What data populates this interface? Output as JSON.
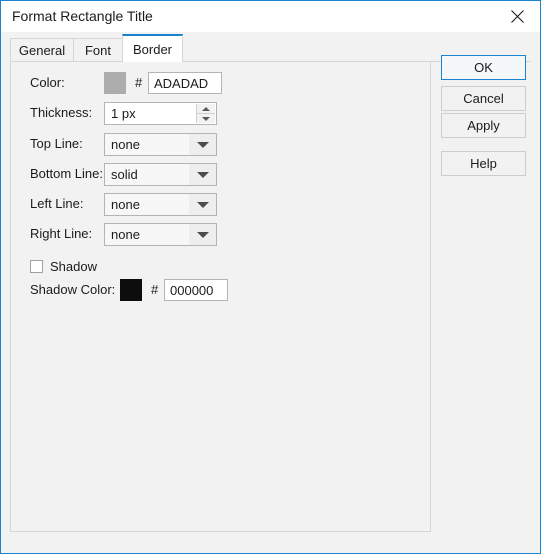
{
  "window": {
    "title": "Format Rectangle Title",
    "close_icon": "close-icon",
    "accent_color": "#1a84d0",
    "background_color": "#f1f2f1"
  },
  "tabs": [
    {
      "label": "General",
      "active": false
    },
    {
      "label": "Font",
      "active": false
    },
    {
      "label": "Border",
      "active": true
    }
  ],
  "form": {
    "color": {
      "label": "Color:",
      "swatch_color": "#adadad",
      "hash": "#",
      "value": "ADADAD"
    },
    "thickness": {
      "label": "Thickness:",
      "value": "1 px",
      "spin_up_icon": "triangle-up-icon",
      "spin_down_icon": "triangle-down-icon"
    },
    "top_line": {
      "label": "Top Line:",
      "value": "none",
      "arrow_icon": "chevron-down-icon"
    },
    "bottom_line": {
      "label": "Bottom Line:",
      "value": "solid",
      "arrow_icon": "chevron-down-icon"
    },
    "left_line": {
      "label": "Left Line:",
      "value": "none",
      "arrow_icon": "chevron-down-icon"
    },
    "right_line": {
      "label": "Right Line:",
      "value": "none",
      "arrow_icon": "chevron-down-icon"
    },
    "shadow": {
      "label": "Shadow",
      "checked": false
    },
    "shadow_color": {
      "label": "Shadow Color:",
      "swatch_color": "#0d0d0d",
      "hash": "#",
      "value": "000000"
    }
  },
  "buttons": {
    "ok": "OK",
    "cancel": "Cancel",
    "apply": "Apply",
    "help": "Help"
  }
}
